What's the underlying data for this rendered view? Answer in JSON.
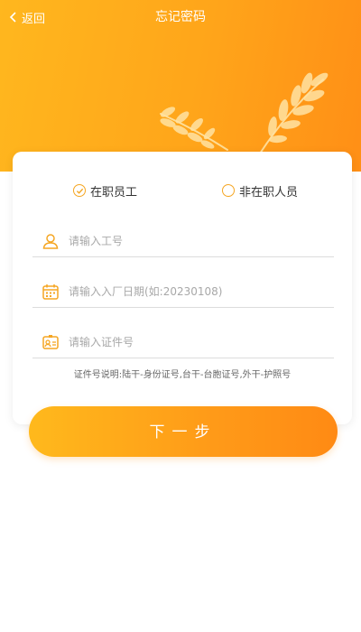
{
  "header": {
    "back_label": "返回",
    "title": "忘记密码"
  },
  "status": {
    "options": [
      {
        "label": "在职员工",
        "selected": true
      },
      {
        "label": "非在职人员",
        "selected": false
      }
    ]
  },
  "form": {
    "employee_id": {
      "value": "",
      "placeholder": "请输入工号",
      "icon": "user-icon"
    },
    "entry_date": {
      "value": "",
      "placeholder": "请输入入厂日期(如:20230108)",
      "icon": "calendar-icon"
    },
    "id_number": {
      "value": "",
      "placeholder": "请输入证件号",
      "icon": "id-card-icon"
    },
    "hint": "证件号说明:陆干-身份证号,台干-台胞证号,外干-护照号"
  },
  "next_button_label": "下一步",
  "colors": {
    "accent": "#f5a623",
    "header_start": "#ffb71e",
    "header_end": "#ff8f16"
  }
}
